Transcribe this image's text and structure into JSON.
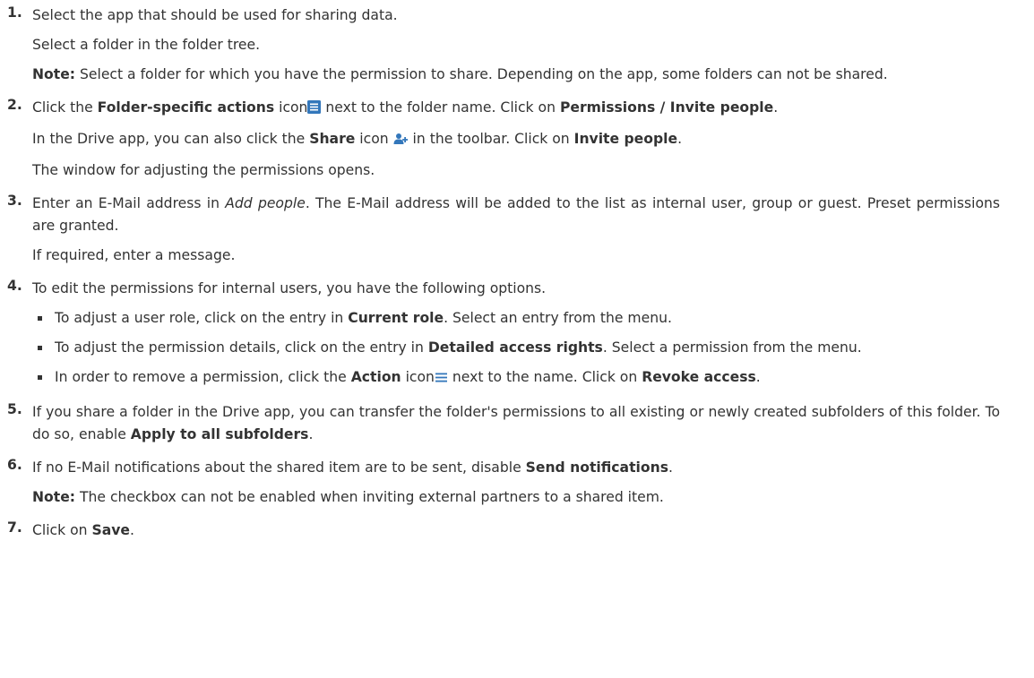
{
  "steps": [
    {
      "num": "1.",
      "p1": "Select the app that should be used for sharing data.",
      "p2": "Select a folder in the folder tree.",
      "note_label": "Note:",
      "note_text": " Select a folder for which you have the permission to share. Depending on the app, some folders can not be shared."
    },
    {
      "num": "2.",
      "p1_a": "Click the ",
      "p1_b": "Folder-specific actions",
      "p1_c": " icon",
      "p1_d": " next to the folder name. Click on ",
      "p1_e": "Permissions / Invite people",
      "p1_f": ".",
      "p2_a": "In the Drive app, you can also click the ",
      "p2_b": "Share",
      "p2_c": " icon ",
      "p2_d": " in the toolbar. Click on ",
      "p2_e": "Invite people",
      "p2_f": ".",
      "p3": "The window for adjusting the permissions opens."
    },
    {
      "num": "3.",
      "p1_a": "Enter an E-Mail address in ",
      "p1_b": "Add people",
      "p1_c": ". The E-Mail address will be added to the list as internal user, group or guest. Preset permissions are granted.",
      "p2": "If required, enter a message."
    },
    {
      "num": "4.",
      "p1": "To edit the permissions for internal users, you have the following options.",
      "bullets": [
        {
          "a": "To adjust a user role, click on the entry in ",
          "b": "Current role",
          "c": ". Select an entry from the menu."
        },
        {
          "a": "To adjust the permission details, click on the entry in ",
          "b": "Detailed access rights",
          "c": ". Select a permission from the menu."
        },
        {
          "a": "In order to remove a permission, click the ",
          "b": "Action",
          "c": " icon",
          "d": " next to the name. Click on ",
          "e": "Revoke access",
          "f": "."
        }
      ]
    },
    {
      "num": "5.",
      "p1_a": "If you share a folder in the Drive app, you can transfer the folder's permissions to all existing or newly created subfolders of this folder. To do so, enable ",
      "p1_b": "Apply to all subfolders",
      "p1_c": "."
    },
    {
      "num": "6.",
      "p1_a": "If no E-Mail notifications about the shared item are to be sent, disable ",
      "p1_b": "Send notifications",
      "p1_c": ".",
      "note_label": "Note:",
      "note_text": " The checkbox can not be enabled when inviting external partners to a shared item."
    },
    {
      "num": "7.",
      "p1_a": "Click on ",
      "p1_b": "Save",
      "p1_c": "."
    }
  ],
  "icons": {
    "folder_actions": "folder-actions-icon",
    "share": "share-icon",
    "action": "action-icon",
    "accent": "#3377bb"
  }
}
